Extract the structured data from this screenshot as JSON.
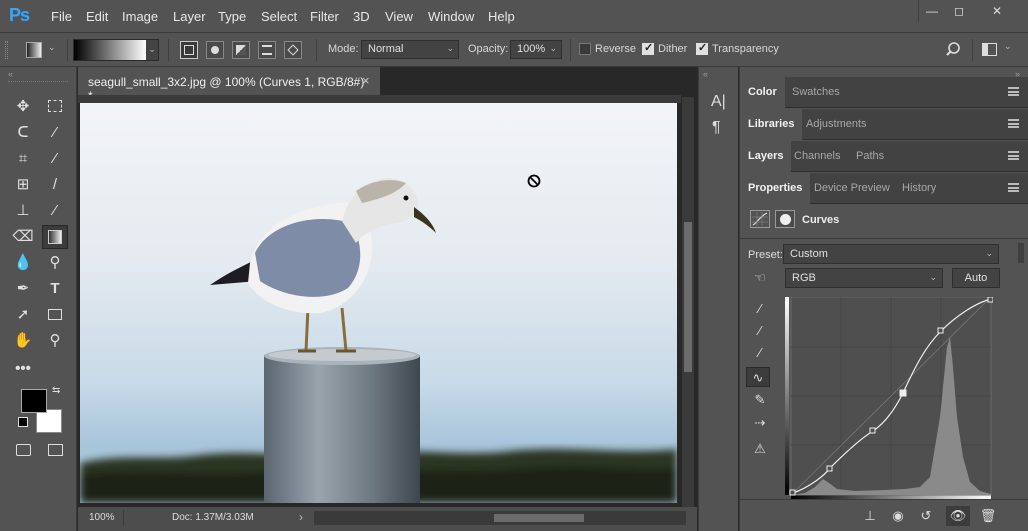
{
  "app": {
    "logo": "Ps"
  },
  "menu": [
    "File",
    "Edit",
    "Image",
    "Layer",
    "Type",
    "Select",
    "Filter",
    "3D",
    "View",
    "Window",
    "Help"
  ],
  "window_controls": {
    "minimize": "—",
    "restore": "◻",
    "close": "✕"
  },
  "options": {
    "mode_label": "Mode:",
    "mode_value": "Normal",
    "opacity_label": "Opacity:",
    "opacity_value": "100%",
    "reverse_label": "Reverse",
    "reverse_checked": false,
    "dither_label": "Dither",
    "dither_checked": true,
    "transparency_label": "Transparency",
    "transparency_checked": true
  },
  "document": {
    "tab_title": "seagull_small_3x2.jpg @ 100% (Curves 1, RGB/8#) *",
    "close": "×",
    "zoom": "100%",
    "doc_info": "Doc: 1.37M/3.03M",
    "nav_arrow": "›"
  },
  "panels": {
    "group1": [
      "Color",
      "Swatches"
    ],
    "group2": [
      "Libraries",
      "Adjustments"
    ],
    "group3": [
      "Layers",
      "Channels",
      "Paths"
    ],
    "group4": [
      "Properties",
      "Device Preview",
      "History"
    ],
    "properties_title": "Curves",
    "preset_label": "Preset:",
    "preset_value": "Custom",
    "channel_value": "RGB",
    "auto_label": "Auto"
  },
  "colors": {
    "foreground": "#000000",
    "background": "#ffffff",
    "accent": "#31a8ff"
  }
}
